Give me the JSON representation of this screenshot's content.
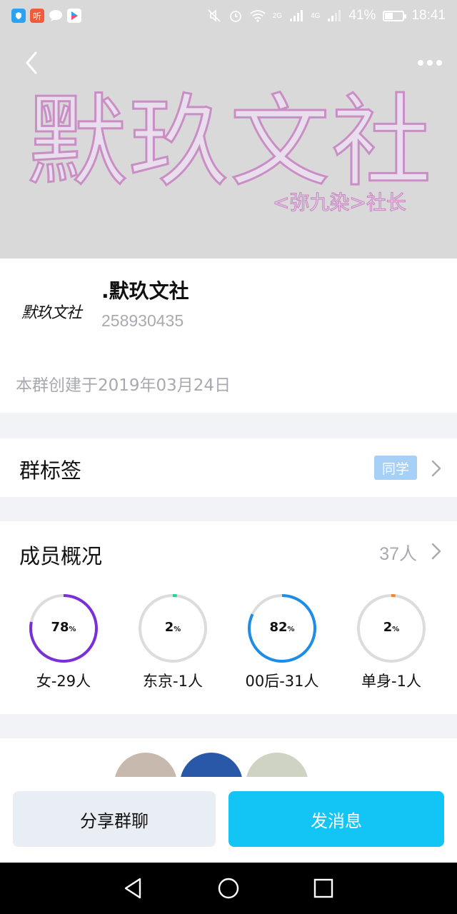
{
  "status_bar": {
    "app_icons": [
      "shield-app-icon",
      "ting-app-icon",
      "chat-bubble-icon",
      "video-app-icon"
    ],
    "ting_label": "听",
    "network_label_2g": "2G",
    "network_label_4g": "4G",
    "battery": "41%",
    "time": "18:41"
  },
  "cover": {
    "title": "默玖文社",
    "subtitle": "<弥九染>社长"
  },
  "group": {
    "avatar_text": "默玖文社",
    "name": ".默玖文社",
    "id": "258930435",
    "created": "本群创建于2019年03月24日"
  },
  "tags": {
    "title": "群标签",
    "tag": "同学"
  },
  "members": {
    "title": "成员概况",
    "count": "37人",
    "stats": [
      {
        "value": "78",
        "unit": "%",
        "label": "女-29人",
        "percent": 78,
        "color": "#7b2fd6"
      },
      {
        "value": "2",
        "unit": "%",
        "label": "东京-1人",
        "percent": 2,
        "color": "#29d0a0"
      },
      {
        "value": "82",
        "unit": "%",
        "label": "00后-31人",
        "percent": 82,
        "color": "#1c8ee8"
      },
      {
        "value": "2",
        "unit": "%",
        "label": "单身-1人",
        "percent": 2,
        "color": "#f08a2c"
      }
    ]
  },
  "actions": {
    "share": "分享群聊",
    "message": "发消息"
  }
}
